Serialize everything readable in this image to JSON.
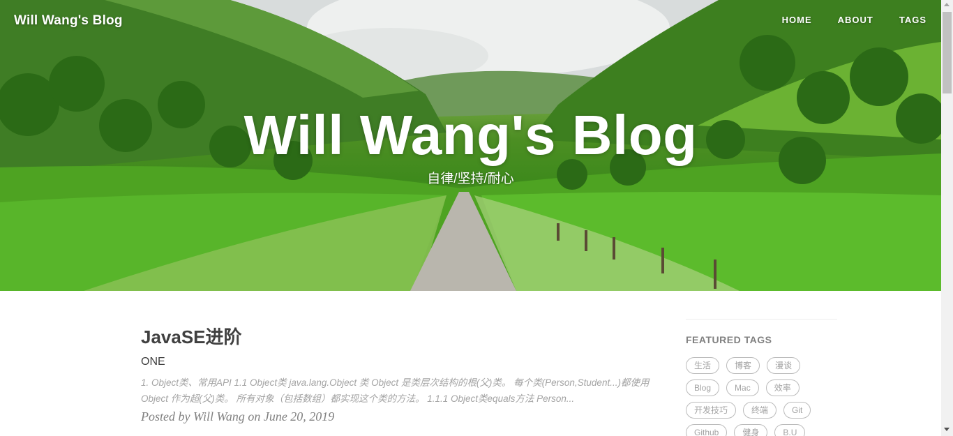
{
  "nav": {
    "brand": "Will Wang's Blog",
    "links": [
      "HOME",
      "ABOUT",
      "TAGS"
    ]
  },
  "hero": {
    "title": "Will Wang's Blog",
    "subtitle": "自律/坚持/耐心"
  },
  "post": {
    "title": "JavaSE进阶",
    "subtitle": "ONE",
    "excerpt": "1. Object类、常用API 1.1 Object类 java.lang.Object 类 Object 是类层次结构的根(父)类。 每个类(Person,Student...)都使用 Object 作为超(父)类。 所有对象（包括数组）都实现这个类的方法。 1.1.1 Object类equals方法 Person...",
    "meta": "Posted by Will Wang on June 20, 2019"
  },
  "sidebar": {
    "heading": "FEATURED TAGS",
    "tags": [
      "生活",
      "博客",
      "漫谈",
      "Blog",
      "Mac",
      "效率",
      "开发技巧",
      "终端",
      "Git",
      "Github",
      "健身",
      "B.U"
    ]
  },
  "colors": {
    "text_dark": "#404040",
    "text_muted": "#a3a3a3",
    "meta": "#808080",
    "tag_border": "#bbbbbb"
  },
  "icons": [
    "scroll-up-arrow-icon",
    "scroll-down-arrow-icon"
  ]
}
